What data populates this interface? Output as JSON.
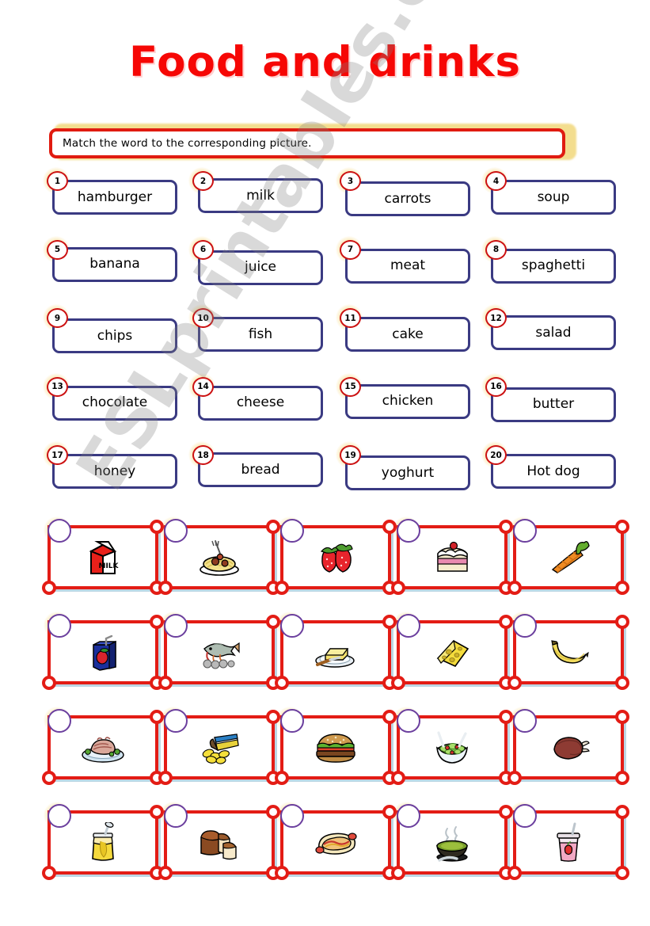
{
  "title": "Food and drinks",
  "instruction": "Match the word to the corresponding picture.",
  "watermark": "ESLprintables.com",
  "colors": {
    "title_red": "#f60705",
    "instruction_border": "#e01b10",
    "instruction_glow": "#f3dd8e",
    "word_box_border": "#3a3a82",
    "word_number_border": "#cc1112",
    "picture_border": "#e31c15",
    "picture_shadow": "#bcd7e4",
    "picture_circle_border": "#6b3f9e"
  },
  "words": [
    {
      "number": "1",
      "label": "hamburger"
    },
    {
      "number": "2",
      "label": "milk"
    },
    {
      "number": "3",
      "label": "carrots"
    },
    {
      "number": "4",
      "label": "soup"
    },
    {
      "number": "5",
      "label": "banana"
    },
    {
      "number": "6",
      "label": "juice"
    },
    {
      "number": "7",
      "label": "meat"
    },
    {
      "number": "8",
      "label": "spaghetti"
    },
    {
      "number": "9",
      "label": "chips"
    },
    {
      "number": "10",
      "label": "fish"
    },
    {
      "number": "11",
      "label": "cake"
    },
    {
      "number": "12",
      "label": "salad"
    },
    {
      "number": "13",
      "label": "chocolate"
    },
    {
      "number": "14",
      "label": "cheese"
    },
    {
      "number": "15",
      "label": "chicken"
    },
    {
      "number": "16",
      "label": "butter"
    },
    {
      "number": "17",
      "label": "honey"
    },
    {
      "number": "18",
      "label": "bread"
    },
    {
      "number": "19",
      "label": "yoghurt"
    },
    {
      "number": "20",
      "label": "Hot dog"
    }
  ],
  "pictures": [
    {
      "icon": "milk-carton-icon",
      "answer": ""
    },
    {
      "icon": "spaghetti-icon",
      "answer": ""
    },
    {
      "icon": "strawberries-icon",
      "answer": ""
    },
    {
      "icon": "cake-slice-icon",
      "answer": ""
    },
    {
      "icon": "carrots-icon",
      "answer": ""
    },
    {
      "icon": "juice-box-icon",
      "answer": ""
    },
    {
      "icon": "grilled-fish-icon",
      "answer": ""
    },
    {
      "icon": "butter-icon",
      "answer": ""
    },
    {
      "icon": "cheese-icon",
      "answer": ""
    },
    {
      "icon": "banana-icon",
      "answer": ""
    },
    {
      "icon": "roast-meat-icon",
      "answer": ""
    },
    {
      "icon": "chips-bag-icon",
      "answer": ""
    },
    {
      "icon": "hamburger-icon",
      "answer": ""
    },
    {
      "icon": "salad-bowl-icon",
      "answer": ""
    },
    {
      "icon": "roast-chicken-icon",
      "answer": ""
    },
    {
      "icon": "honey-jar-icon",
      "answer": ""
    },
    {
      "icon": "bread-loaf-icon",
      "answer": ""
    },
    {
      "icon": "hot-dog-icon",
      "answer": ""
    },
    {
      "icon": "soup-bowl-icon",
      "answer": ""
    },
    {
      "icon": "yoghurt-cup-icon",
      "answer": ""
    }
  ]
}
